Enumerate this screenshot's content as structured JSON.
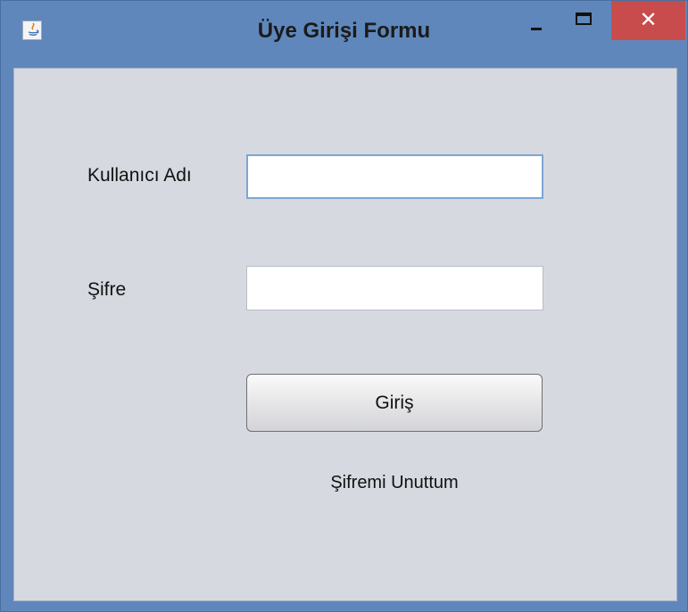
{
  "window": {
    "title": "Üye Girişi Formu",
    "close_glyph": "✕",
    "icons": [
      "java-app-icon",
      "minimize-icon",
      "maximize-icon",
      "close-icon"
    ]
  },
  "form": {
    "username_label": "Kullanıcı Adı",
    "username_value": "",
    "password_label": "Şifre",
    "password_value": "",
    "login_button": "Giriş",
    "forgot_link": "Şifremi Unuttum"
  },
  "colors": {
    "titlebar": "#5f87bb",
    "client_background": "#d6d9e0",
    "close_button": "#c94c4c",
    "focused_field_border": "#7ea6d3"
  }
}
